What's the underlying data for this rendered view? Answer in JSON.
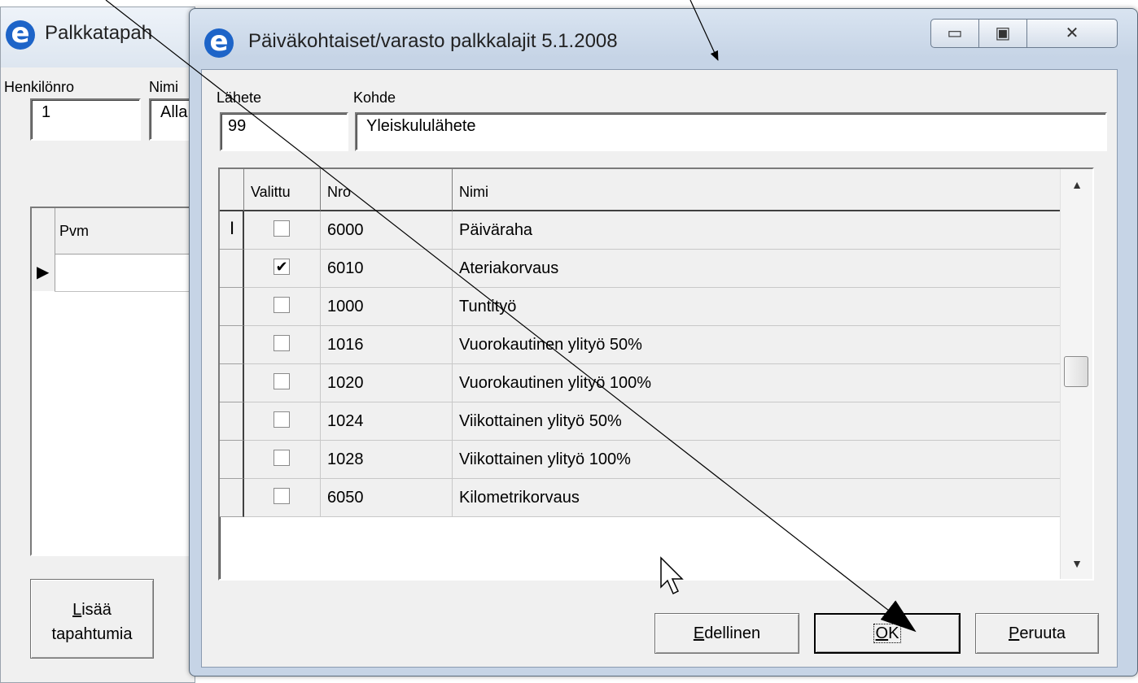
{
  "bg_window": {
    "title": "Palkkatapah",
    "henkilonro_label": "Henkilönro",
    "nimi_label": "Nimi",
    "henkilonro_value": "1",
    "nimi_value": "Alla",
    "grid": {
      "col_pvm": "Pvm"
    },
    "add_button": {
      "accel": "L",
      "rest": "isää",
      "line2": "tapahtumia"
    }
  },
  "dialog": {
    "title": "Päiväkohtaiset/varasto palkkalajit 5.1.2008",
    "lahete_label": "Lähete",
    "kohde_label": "Kohde",
    "lahete_value": "99",
    "kohde_value": "Yleiskululähete",
    "columns": {
      "valittu": "Valittu",
      "nro": "Nro",
      "nimi": "Nimi"
    },
    "rows": [
      {
        "checked": false,
        "nro": "6000",
        "nimi": "Päiväraha"
      },
      {
        "checked": true,
        "nro": "6010",
        "nimi": "Ateriakorvaus"
      },
      {
        "checked": false,
        "nro": "1000",
        "nimi": "Tuntityö"
      },
      {
        "checked": false,
        "nro": "1016",
        "nimi": "Vuorokautinen ylityö 50%"
      },
      {
        "checked": false,
        "nro": "1020",
        "nimi": "Vuorokautinen ylityö 100%"
      },
      {
        "checked": false,
        "nro": "1024",
        "nimi": "Viikottainen ylityö 50%"
      },
      {
        "checked": false,
        "nro": "1028",
        "nimi": "Viikottainen ylityö 100%"
      },
      {
        "checked": false,
        "nro": "6050",
        "nimi": "Kilometrikorvaus"
      }
    ],
    "buttons": {
      "edellinen": {
        "accel": "E",
        "rest": "dellinen"
      },
      "ok": {
        "accel": "O",
        "rest": "K"
      },
      "peruuta": {
        "accel": "P",
        "rest": "eruuta"
      }
    }
  }
}
